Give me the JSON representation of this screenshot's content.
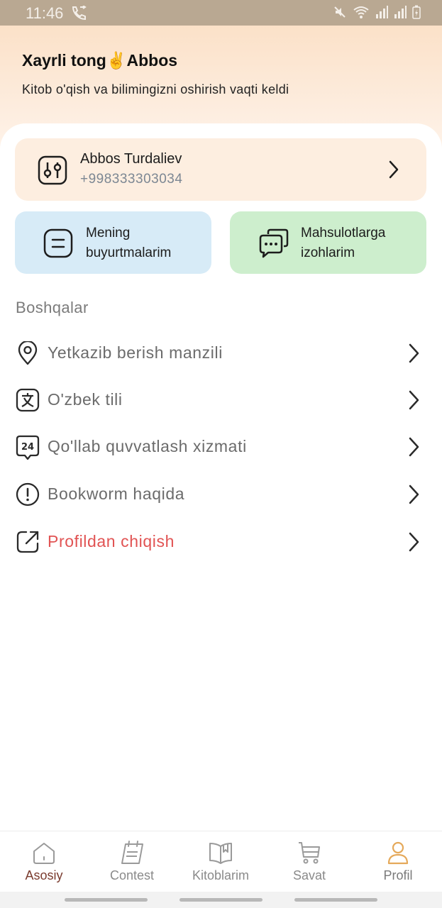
{
  "status_bar": {
    "time": "11:46"
  },
  "header": {
    "greeting": "Xayrli tong✌️Abbos",
    "subtitle": "Kitob o'qish va bilimingizni oshirish vaqti keldi"
  },
  "profile": {
    "name": "Abbos Turdaliev",
    "phone": "+998333303034"
  },
  "tiles": {
    "orders": {
      "line1": "Mening",
      "line2": "buyurtmalarim"
    },
    "reviews": {
      "line1": "Mahsulotlarga",
      "line2": "izohlarim"
    }
  },
  "section": {
    "title": "Boshqalar"
  },
  "menu": [
    {
      "label": "Yetkazib berish manzili",
      "icon": "location-pin-icon"
    },
    {
      "label": "O'zbek tili",
      "icon": "language-icon"
    },
    {
      "label": "Qo'llab quvvatlash xizmati",
      "icon": "support-24-icon"
    },
    {
      "label": "Bookworm haqida",
      "icon": "info-icon"
    },
    {
      "label": "Profildan chiqish",
      "icon": "logout-icon",
      "color": "#e15353"
    }
  ],
  "bottom_nav": [
    {
      "label": "Asosiy",
      "icon": "home-icon",
      "active": true
    },
    {
      "label": "Contest",
      "icon": "contest-icon"
    },
    {
      "label": "Kitoblarim",
      "icon": "book-icon"
    },
    {
      "label": "Savat",
      "icon": "cart-icon"
    },
    {
      "label": "Profil",
      "icon": "profile-icon"
    }
  ],
  "colors": {
    "accent": "#e5a95a",
    "danger": "#e15353",
    "orders_tile": "#d7ebf7",
    "reviews_tile": "#cdeecd",
    "profile_card": "#fdeee0"
  }
}
